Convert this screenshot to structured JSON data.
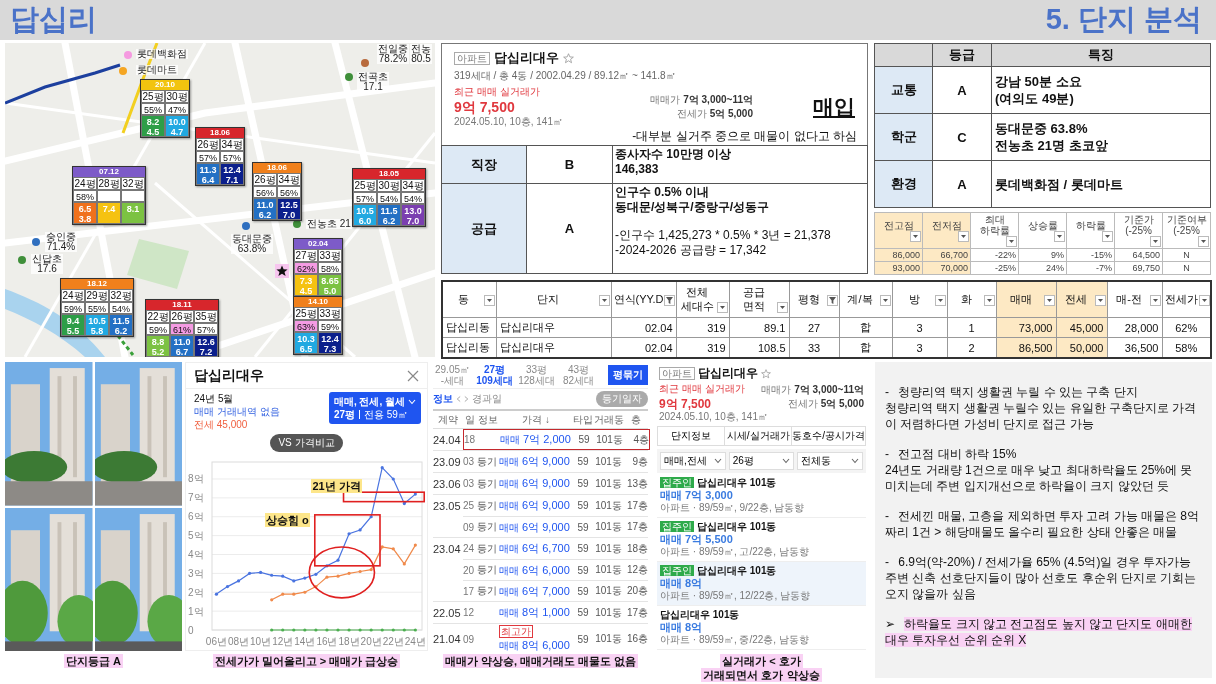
{
  "header": {
    "title": "답십리",
    "section": "5. 단지 분석"
  },
  "map": {
    "places": [
      {
        "name": "롯데백화점",
        "color": "#f59ae0"
      },
      {
        "name": "전일중",
        "value": "78.2%",
        "color": "#b86a3c"
      },
      {
        "name": "전농",
        "value": "80.5"
      },
      {
        "name": "롯데마트",
        "color": "#f5a623"
      },
      {
        "name": "전곡초",
        "value": "17.1",
        "color": "#3f8f3a"
      },
      {
        "name": "전농초",
        "value": "21",
        "color": "#3f8f3a"
      },
      {
        "name": "숭인중",
        "value": "71.4%",
        "color": "#2f6fbf"
      },
      {
        "name": "동대문중",
        "value": "63.8%",
        "color": "#2f6fbf"
      },
      {
        "name": "신답초",
        "value": "17.6",
        "color": "#3f8f3a"
      }
    ],
    "marker": {
      "kind": "star"
    },
    "boxes": [
      {
        "built": "20.10",
        "color": "#f2c40f",
        "cols": [
          {
            "size": "25평",
            "ratio": "55%",
            "highlighted": false,
            "sale": "8.2",
            "jeonse": "4.5",
            "color": "#2e9e48"
          },
          {
            "size": "30평",
            "ratio": "47%",
            "highlighted": false,
            "sale": "10.0",
            "jeonse": "4.7",
            "color": "#21a9e1"
          }
        ]
      },
      {
        "built": "18.06",
        "color": "#d7262c",
        "cols": [
          {
            "size": "26평",
            "ratio": "57%",
            "highlighted": false,
            "sale": "11.3",
            "jeonse": "6.4",
            "color": "#2370c4"
          },
          {
            "size": "34평",
            "ratio": "57%",
            "highlighted": false,
            "sale": "12.4",
            "jeonse": "7.1",
            "color": "#0b1f8c"
          }
        ]
      },
      {
        "built": "07.12",
        "color": "#7d5bc8",
        "cols": [
          {
            "size": "24평",
            "ratio": "58%",
            "highlighted": false,
            "sale": "6.5",
            "jeonse": "3.8",
            "color": "#f0711c"
          },
          {
            "size": "28평",
            "highlighted": false,
            "sale": "7.4",
            "color": "#f5c211"
          },
          {
            "size": "32평",
            "highlighted": false,
            "sale": "8.1",
            "color": "#7cc242"
          }
        ]
      },
      {
        "built": "18.06",
        "color": "#f0801c",
        "cols": [
          {
            "size": "26평",
            "ratio": "56%",
            "highlighted": false,
            "sale": "11.0",
            "jeonse": "6.2",
            "color": "#2370c4"
          },
          {
            "size": "34평",
            "ratio": "56%",
            "highlighted": false,
            "sale": "12.5",
            "jeonse": "7.0",
            "color": "#0b1f8c"
          }
        ]
      },
      {
        "built": "18.05",
        "color": "#d7262c",
        "cols": [
          {
            "size": "25평",
            "ratio": "57%",
            "highlighted": false,
            "sale": "10.5",
            "jeonse": "6.0",
            "color": "#21a9e1"
          },
          {
            "size": "30평",
            "ratio": "54%",
            "highlighted": false,
            "sale": "11.5",
            "jeonse": "6.2",
            "color": "#2370c4"
          },
          {
            "size": "34평",
            "ratio": "54%",
            "highlighted": false,
            "sale": "13.0",
            "jeonse": "7.0",
            "color": "#7b3fb0"
          }
        ]
      },
      {
        "built": "02.04",
        "color": "#7d5bc8",
        "cols": [
          {
            "size": "27평",
            "ratio": "62%",
            "highlighted": true,
            "sale": "7.3",
            "jeonse": "4.5",
            "color": "#f5c211"
          },
          {
            "size": "33평",
            "ratio": "58%",
            "highlighted": false,
            "sale": "8.65",
            "jeonse": "5.0",
            "color": "#7cc242"
          }
        ]
      },
      {
        "built": "14.10",
        "color": "#f0801c",
        "cols": [
          {
            "size": "25평",
            "ratio": "63%",
            "highlighted": true,
            "sale": "10.3",
            "jeonse": "6.5",
            "color": "#21a9e1"
          },
          {
            "size": "33평",
            "ratio": "59%",
            "highlighted": false,
            "sale": "12.4",
            "jeonse": "7.3",
            "color": "#0b1f8c"
          }
        ]
      },
      {
        "built": "18.12",
        "color": "#f0801c",
        "cols": [
          {
            "size": "24평",
            "ratio": "59%",
            "highlighted": false,
            "sale": "9.4",
            "jeonse": "5.5",
            "color": "#2e9e48"
          },
          {
            "size": "29평",
            "ratio": "55%",
            "highlighted": false,
            "sale": "10.5",
            "jeonse": "5.8",
            "color": "#21a9e1"
          },
          {
            "size": "32평",
            "ratio": "54%",
            "highlighted": false,
            "sale": "11.5",
            "jeonse": "6.2",
            "color": "#2370c4"
          }
        ]
      },
      {
        "built": "18.11",
        "color": "#d7262c",
        "cols": [
          {
            "size": "22평",
            "ratio": "59%",
            "highlighted": false,
            "sale": "8.8",
            "jeonse": "5.2",
            "color": "#7cc242"
          },
          {
            "size": "26평",
            "ratio": "61%",
            "highlighted": true,
            "sale": "11.0",
            "jeonse": "6.7",
            "color": "#2370c4"
          },
          {
            "size": "35평",
            "ratio": "57%",
            "highlighted": false,
            "sale": "12.6",
            "jeonse": "7.2",
            "color": "#0b1f8c"
          }
        ]
      }
    ]
  },
  "listing_card": {
    "tag": "아파트",
    "name": "답십리대우",
    "meta": "319세대 / 총 4동 / 2002.04.29 / 89.12㎡ ~ 141.8㎡",
    "recent_label": "최근 매매 실거래가",
    "recent_price": "9억 7,500",
    "recent_detail": "2024.05.10, 10층, 141㎡",
    "ranges": [
      {
        "label": "매매가",
        "value": "7억 3,000~11억"
      },
      {
        "label": "전세가",
        "value": "5억 5,000"
      }
    ],
    "verdict": "매입",
    "remark": "-대부분 실거주 중으로 매물이 없다고 하심"
  },
  "factors": [
    {
      "label": "직장",
      "grade": "B",
      "paragraphs": [
        {
          "lines": [
            "종사자수 10만명 이상",
            "146,383"
          ],
          "bold": true
        }
      ]
    },
    {
      "label": "공급",
      "grade": "A",
      "paragraphs": [
        {
          "lines": [
            "인구수 0.5% 이내",
            "동대문/성북구/중랑구/성동구"
          ],
          "bold": true
        },
        {
          "lines": [
            "-인구수 1,425,273 * 0.5% * 3년 = 21,378",
            "-2024-2026 공급량 = 17,342"
          ],
          "bold": false
        }
      ]
    }
  ],
  "grades": {
    "columns": [
      "등급",
      "특징"
    ],
    "rows": [
      {
        "label": "교통",
        "grade": "A",
        "lines": [
          "강남 50분 소요",
          "(여의도 49분)"
        ]
      },
      {
        "label": "학군",
        "grade": "C",
        "lines": [
          "동대문중 63.8%",
          "전농초 21명 초코앞"
        ]
      },
      {
        "label": "환경",
        "grade": "A",
        "lines": [
          "롯데백화점 / 롯데마트"
        ]
      }
    ]
  },
  "price_stats": {
    "columns": [
      {
        "lines": [
          "전고점"
        ],
        "highlight": true
      },
      {
        "lines": [
          "전저점"
        ],
        "highlight": true
      },
      {
        "lines": [
          "최대",
          "하락률"
        ],
        "highlight": false
      },
      {
        "lines": [
          "상승률"
        ],
        "highlight": false
      },
      {
        "lines": [
          "하락률"
        ],
        "highlight": false
      },
      {
        "lines": [
          "기준가",
          "(-25%"
        ],
        "highlight": false
      },
      {
        "lines": [
          "기준여부",
          "(-25%"
        ],
        "highlight": false
      }
    ],
    "rows": [
      [
        "86,000",
        "66,700",
        "-22%",
        "9%",
        "-15%",
        "64,500",
        "N"
      ],
      [
        "93,000",
        "70,000",
        "-25%",
        "24%",
        "-7%",
        "69,750",
        "N"
      ]
    ]
  },
  "complex_table": {
    "columns": [
      {
        "lines": [
          "동"
        ],
        "filtered": false,
        "highlight": false
      },
      {
        "lines": [
          "단지"
        ],
        "filtered": false,
        "highlight": false
      },
      {
        "lines": [
          "연식(YY.D"
        ],
        "filtered": true,
        "highlight": false
      },
      {
        "lines": [
          "전체",
          "세대수"
        ],
        "filtered": false,
        "highlight": false
      },
      {
        "lines": [
          "공급",
          "면적"
        ],
        "filtered": false,
        "highlight": false
      },
      {
        "lines": [
          "평형"
        ],
        "filtered": true,
        "highlight": false
      },
      {
        "lines": [
          "계/복"
        ],
        "filtered": false,
        "highlight": false
      },
      {
        "lines": [
          "방"
        ],
        "filtered": false,
        "highlight": false
      },
      {
        "lines": [
          "화"
        ],
        "filtered": false,
        "highlight": false
      },
      {
        "lines": [
          "매매"
        ],
        "filtered": false,
        "highlight": true
      },
      {
        "lines": [
          "전세"
        ],
        "filtered": false,
        "highlight": true
      },
      {
        "lines": [
          "매-전"
        ],
        "filtered": false,
        "highlight": false
      },
      {
        "lines": [
          "전세가"
        ],
        "filtered": false,
        "highlight": false
      }
    ],
    "rows": [
      [
        "답십리동",
        "답십리대우",
        "02.04",
        "319",
        "89.1",
        "27",
        "합",
        "3",
        "1",
        "73,000",
        "45,000",
        "28,000",
        "62%"
      ],
      [
        "답십리동",
        "답십리대우",
        "02.04",
        "319",
        "108.5",
        "33",
        "합",
        "3",
        "2",
        "86,500",
        "50,000",
        "36,500",
        "58%"
      ]
    ]
  },
  "photo_panel": {
    "photos": [
      {
        "kind": "road"
      },
      {
        "kind": "road"
      },
      {
        "kind": "trees"
      },
      {
        "kind": "trees"
      }
    ],
    "caption": "단지등급 A"
  },
  "chart_panel": {
    "title": "답십리대우",
    "month": "24년 5월",
    "sale_status": "매매 거래내역 없음",
    "jeonse_status": "전세 45,000",
    "filter": {
      "types": "매매, 전세, 월세",
      "size": "27평",
      "area": "전용 59㎡"
    },
    "compare": "VS 가격비교",
    "chart_data": {
      "type": "line",
      "x": [
        6,
        7,
        8,
        9,
        10,
        11,
        12,
        13,
        14,
        15,
        16,
        17,
        18,
        19,
        20,
        21,
        22,
        23,
        24
      ],
      "series": [
        {
          "color": "#4a74e0",
          "values": [
            1.9,
            2.3,
            2.6,
            3.0,
            3.05,
            2.9,
            2.85,
            2.6,
            2.75,
            2.95,
            3.4,
            3.7,
            5.1,
            5.3,
            6.0,
            8.6,
            8.0,
            6.7,
            7.2
          ]
        },
        {
          "color": "#f08a4b",
          "values": [
            null,
            null,
            null,
            null,
            null,
            1.6,
            1.9,
            1.9,
            2.0,
            2.3,
            2.8,
            2.85,
            3.0,
            3.1,
            3.2,
            4.4,
            4.3,
            3.5,
            4.5
          ]
        },
        {
          "color": "#4caf50",
          "values": [
            null,
            null,
            null,
            null,
            null,
            0,
            0,
            0,
            0,
            0,
            0,
            0,
            0,
            0,
            0,
            0,
            0,
            0,
            0
          ]
        }
      ],
      "xlim": [
        5.6,
        24.6
      ],
      "ylim": [
        0,
        8.9
      ],
      "grid": true,
      "xticks": [
        {
          "value": 6,
          "label": "06년"
        },
        {
          "value": 8,
          "label": "08년"
        },
        {
          "value": 10,
          "label": "10년"
        },
        {
          "value": 12,
          "label": "12년"
        },
        {
          "value": 14,
          "label": "14년"
        },
        {
          "value": 16,
          "label": "16년"
        },
        {
          "value": 18,
          "label": "18년"
        },
        {
          "value": 20,
          "label": "20년"
        },
        {
          "value": 22,
          "label": "22년"
        },
        {
          "value": 24,
          "label": "24년"
        }
      ],
      "yticks": [
        {
          "value": 0,
          "label": "0"
        },
        {
          "value": 1,
          "label": "1억"
        },
        {
          "value": 2,
          "label": "2억"
        },
        {
          "value": 3,
          "label": "3억"
        },
        {
          "value": 4,
          "label": "4억"
        },
        {
          "value": 5,
          "label": "5억"
        },
        {
          "value": 6,
          "label": "6억"
        },
        {
          "value": 7,
          "label": "7억"
        },
        {
          "value": 8,
          "label": "8억"
        }
      ]
    },
    "callouts": [
      {
        "kind": "box",
        "label": "21년 가격"
      },
      {
        "kind": "box",
        "label": "상승힘 o"
      },
      {
        "kind": "circle"
      }
    ],
    "caption": "전세가가 밀어올리고 > 매매가 급상승"
  },
  "transactions": {
    "sizes": [
      {
        "area": "29.05㎡",
        "units": "-세대",
        "selected": false
      },
      {
        "area": "27평",
        "units": "109세대",
        "selected": true
      },
      {
        "area": "33평",
        "units": "128세대",
        "selected": false
      },
      {
        "area": "43평",
        "units": "82세대",
        "selected": false
      }
    ],
    "toggle_button": "평묶기",
    "tabs": [
      {
        "label": "정보",
        "selected": true
      },
      {
        "label": "경과일",
        "selected": false
      }
    ],
    "date_toggle": "등기일자",
    "columns": [
      "계약",
      "일",
      "정보",
      "가격 ↓",
      "타입",
      "거래동",
      "층"
    ],
    "rows": [
      {
        "month": "24.04",
        "day": "18",
        "deal": "매매",
        "price": "7억 2,000",
        "type": "59",
        "dong": "101동",
        "floor": "4층",
        "boxed": true
      },
      {
        "month": "23.09",
        "day": "03",
        "info": "등기",
        "deal": "매매",
        "price": "6억 9,000",
        "type": "59",
        "dong": "101동",
        "floor": "9층",
        "boxed": false
      },
      {
        "month": "23.06",
        "day": "03",
        "info": "등기",
        "deal": "매매",
        "price": "6억 9,000",
        "type": "59",
        "dong": "101동",
        "floor": "13층",
        "boxed": false
      },
      {
        "month": "23.05",
        "day": "25",
        "info": "등기",
        "deal": "매매",
        "price": "6억 9,000",
        "type": "59",
        "dong": "101동",
        "floor": "17층",
        "boxed": false
      },
      {
        "day": "09",
        "info": "등기",
        "deal": "매매",
        "price": "6억 9,000",
        "type": "59",
        "dong": "101동",
        "floor": "17층",
        "boxed": false
      },
      {
        "month": "23.04",
        "day": "24",
        "info": "등기",
        "deal": "매매",
        "price": "6억 6,700",
        "type": "59",
        "dong": "101동",
        "floor": "18층",
        "boxed": false
      },
      {
        "day": "20",
        "info": "등기",
        "deal": "매매",
        "price": "6억 6,000",
        "type": "59",
        "dong": "101동",
        "floor": "12층",
        "boxed": false
      },
      {
        "day": "17",
        "info": "등기",
        "deal": "매매",
        "price": "6억 7,000",
        "type": "59",
        "dong": "101동",
        "floor": "20층",
        "boxed": false
      },
      {
        "month": "22.05",
        "day": "12",
        "deal": "매매",
        "price": "8억 1,000",
        "type": "59",
        "dong": "101동",
        "floor": "17층",
        "boxed": false
      },
      {
        "month": "21.04",
        "day": "09",
        "badge": "최고가",
        "deal": "매매",
        "price": "8억 6,000",
        "type": "59",
        "dong": "101동",
        "floor": "16층",
        "boxed": false
      }
    ],
    "caption": "매매가 약상승, 매매거래도 매물도 없음"
  },
  "listing_panel": {
    "tag": "아파트",
    "name": "답십리대우",
    "recent_label": "최근 매매 실거래가",
    "recent_price": "9억 7,500",
    "recent_detail": "2024.05.10, 10층, 141㎡",
    "ranges": [
      {
        "label": "매매가",
        "value": "7억 3,000~11억"
      },
      {
        "label": "전세가",
        "value": "5억 5,000"
      }
    ],
    "tabs": [
      "단지정보",
      "시세/실거래가",
      "동호수/공시가격"
    ],
    "selects": [
      "매매,전세",
      "26평",
      "전체동"
    ],
    "listings": [
      {
        "badge": "집주인",
        "title": "답십리대우 101동",
        "price": "매매 7억 3,000",
        "detail": "아파트 · 89/59㎡, 9/22층, 남동향",
        "selected": false
      },
      {
        "badge": "집주인",
        "title": "답십리대우 101동",
        "price": "매매 7억 5,500",
        "detail": "아파트 · 89/59㎡, 고/22층, 남동향",
        "selected": false
      },
      {
        "badge": "집주인",
        "title": "답십리대우 101동",
        "price": "매매 8억",
        "detail": "아파트 · 89/59㎡, 12/22층, 남동향",
        "selected": true
      },
      {
        "title": "답십리대우 101동",
        "price": "매매 8억",
        "detail": "아파트 · 89/59㎡, 중/22층, 남동향",
        "selected": false
      }
    ],
    "caption": [
      "실거래가 < 호가",
      "거래되면서 호가 약상승"
    ]
  },
  "notes": {
    "items": [
      {
        "marker": "-",
        "title": "청량리역 택지 생활권 누릴 수 있는 구축 단지",
        "body": "청량리역 택지 생활권 누릴수 있는 유일한 구축단지로 가격이 저렴하다면 가성비 단지로 접근 가능",
        "highlight": false
      },
      {
        "marker": "-",
        "title": "전고점 대비 하락 15%",
        "body": "24년도 거래량 1건으로 매우 낮고 최대하락율도 25%에 못 미치는데 주변 입지개선으로 하락율이 크지 않았던 듯",
        "highlight": false
      },
      {
        "marker": "-",
        "title": "전세낀 매물, 고층을 제외하면 투자 고려 가능 매물은 8억짜리 1건 > 해당매물도 올수리 필요한 상태 안좋은 매물",
        "highlight": false
      },
      {
        "marker": "-",
        "title": "6.9억(약-20%) / 전세가율 65% (4.5억)일 경우 투자가능",
        "body": "주변 신축 선호단지들이 많아 선호도 후순위 단지로 기회는 오지 않을까 싶음",
        "highlight": false
      },
      {
        "marker": "➢",
        "title": "하락율도 크지 않고 전고점도 높지 않고 단지도 애매한 대우 투자우선 순위 순위 X",
        "highlight": true
      }
    ]
  }
}
